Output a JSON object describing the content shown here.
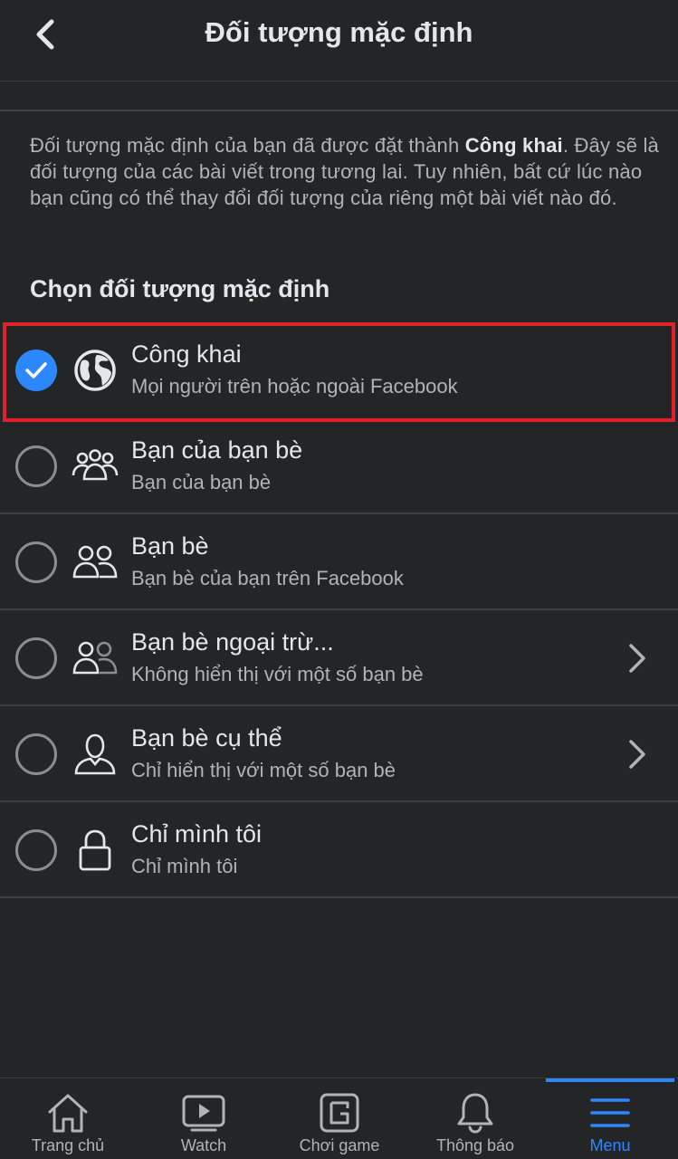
{
  "header": {
    "title": "Đối tượng mặc định"
  },
  "description": {
    "before": "Đối tượng mặc định của bạn đã được đặt thành ",
    "bold": "Công khai",
    "after": ". Đây sẽ là đối tượng của các bài viết trong tương lai. Tuy nhiên, bất cứ lúc nào bạn cũng có thể thay đổi đối tượng của riêng một bài viết nào đó."
  },
  "section_title": "Chọn đối tượng mặc định",
  "options": [
    {
      "label": "Công khai",
      "sub": "Mọi người trên hoặc ngoài Facebook",
      "icon": "globe-icon",
      "selected": true,
      "chevron": false
    },
    {
      "label": "Bạn của bạn bè",
      "sub": "Bạn của bạn bè",
      "icon": "friends-of-friends-icon",
      "selected": false,
      "chevron": false
    },
    {
      "label": "Bạn bè",
      "sub": "Bạn bè của bạn trên Facebook",
      "icon": "friends-icon",
      "selected": false,
      "chevron": false
    },
    {
      "label": "Bạn bè ngoại trừ...",
      "sub": "Không hiển thị với một số bạn bè",
      "icon": "friends-except-icon",
      "selected": false,
      "chevron": true
    },
    {
      "label": "Bạn bè cụ thể",
      "sub": "Chỉ hiển thị với một số bạn bè",
      "icon": "specific-friend-icon",
      "selected": false,
      "chevron": true
    },
    {
      "label": "Chỉ mình tôi",
      "sub": "Chỉ mình tôi",
      "icon": "lock-icon",
      "selected": false,
      "chevron": false
    }
  ],
  "tabbar": [
    {
      "label": "Trang chủ",
      "icon": "home-icon",
      "active": false
    },
    {
      "label": "Watch",
      "icon": "watch-icon",
      "active": false
    },
    {
      "label": "Chơi game",
      "icon": "gaming-icon",
      "active": false
    },
    {
      "label": "Thông báo",
      "icon": "bell-icon",
      "active": false
    },
    {
      "label": "Menu",
      "icon": "menu-icon",
      "active": true
    }
  ],
  "colors": {
    "background": "#242526",
    "accent": "#2d88ff",
    "highlight": "#e0202a",
    "text": "#e4e6eb",
    "secondary": "#b0b3b8"
  }
}
